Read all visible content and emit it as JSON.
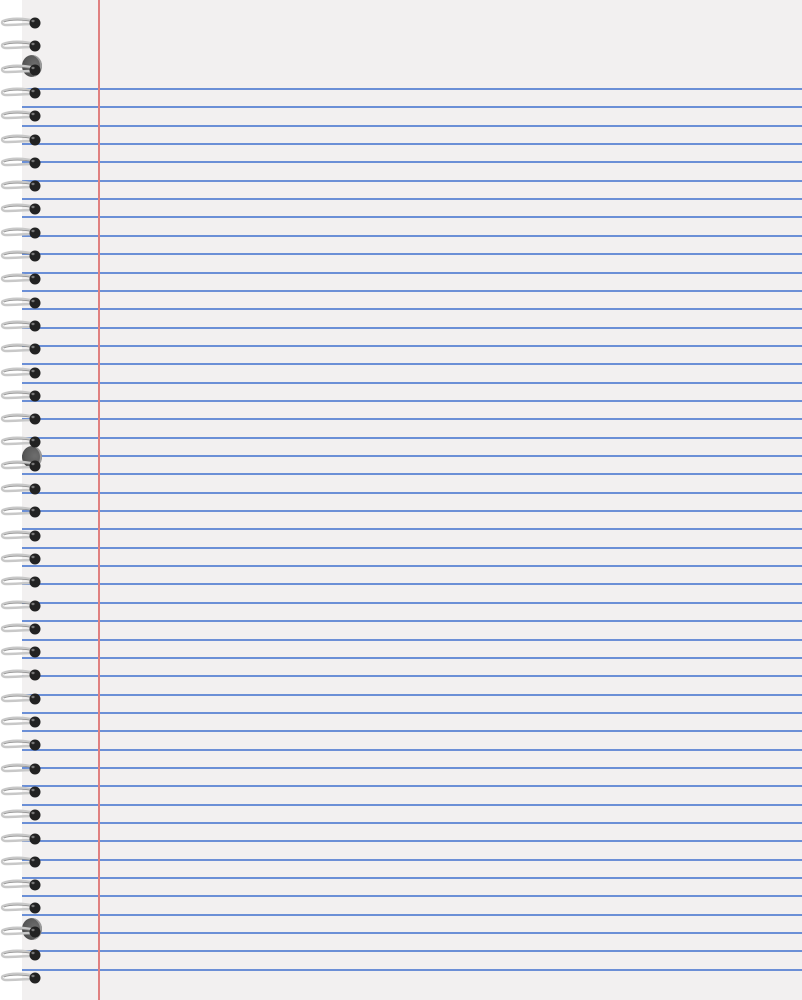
{
  "notebook": {
    "kind": "spiral-bound lined notebook page",
    "colors": {
      "paper": "#f2f0f0",
      "rule_line": "#6b8fd6",
      "margin_line": "#e08080",
      "coil_dark": "#222222",
      "coil_metal": "#c8c8c8",
      "punch_hole": "#5a5a5a"
    },
    "icons": {
      "coil": "spiral-coil-icon",
      "hole": "punch-hole-icon"
    }
  }
}
